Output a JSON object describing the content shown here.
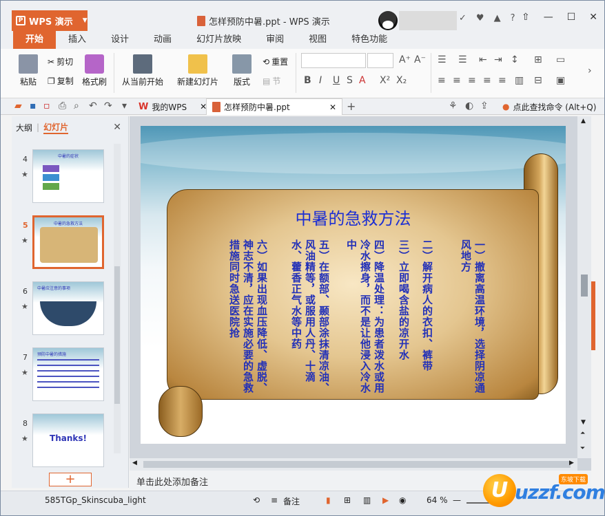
{
  "app": {
    "button_label": "WPS 演示",
    "window_title": "怎样预防中暑.ppt - WPS 演示"
  },
  "ribbon_tabs": [
    "开始",
    "插入",
    "设计",
    "动画",
    "幻灯片放映",
    "审阅",
    "视图",
    "特色功能"
  ],
  "ribbon": {
    "paste": "粘贴",
    "cut": "剪切",
    "copy": "复制",
    "format_painter": "格式刷",
    "from_current": "从当前开始",
    "new_slide": "新建幻灯片",
    "layout": "版式",
    "reset": "重置",
    "section": "节"
  },
  "doc_tabs": {
    "home": "我的WPS",
    "file": "怎样预防中暑.ppt",
    "search_hint": "点此查找命令 (Alt+Q)"
  },
  "left_pane": {
    "tab_outline": "大纲",
    "tab_slides": "幻灯片",
    "slides": [
      {
        "num": "4",
        "title": "中暑的症状"
      },
      {
        "num": "5",
        "title": "中暑的急救方法"
      },
      {
        "num": "6",
        "title": "中暑应注意的事项"
      },
      {
        "num": "7",
        "title": "预防中暑的措施"
      },
      {
        "num": "8",
        "title": "Thanks!"
      }
    ]
  },
  "slide": {
    "title": "中暑的急救方法",
    "items": [
      "一）撤离高温环境，选择阴凉通风地方",
      "二）解开病人的衣扣、裤带",
      "三）立即喝含盐的凉开水",
      "四）降温处理：为患者泼水或用冷水擦身，而不是让他浸入冷水中",
      "五）在额部、颞部涂抹清凉油、风油精等，或服用人丹、十滴水、藿香正气水等中药",
      "六）如果出现血压降低、虚脱、神志不清，应在实施必要的急救措施同时急送医院抢"
    ]
  },
  "notes_placeholder": "单击此处添加备注",
  "status": {
    "theme": "585TGp_Skinscuba_light",
    "notes_btn": "备注",
    "zoom": "64 %"
  },
  "watermark": {
    "text": "uzzf.com",
    "tag": "东坡下载"
  }
}
